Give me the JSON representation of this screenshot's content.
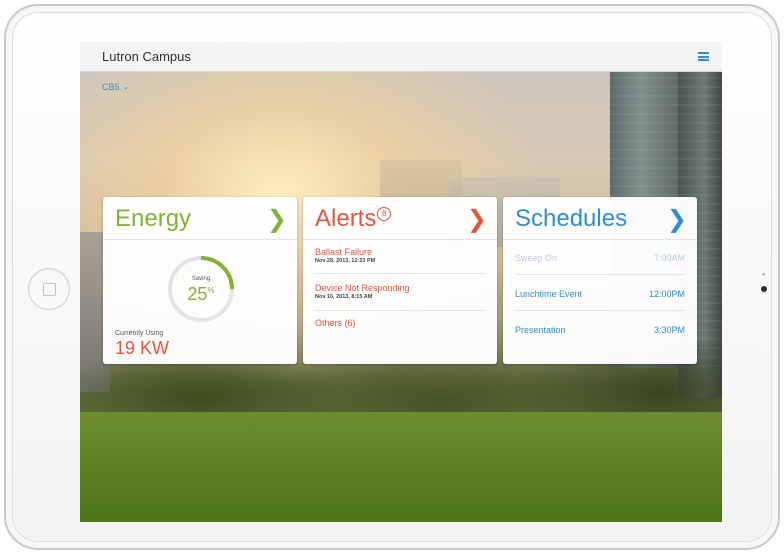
{
  "app": {
    "title": "Lutron Campus",
    "location": "CB5"
  },
  "colors": {
    "energy": "#7fb235",
    "alerts": "#e5553a",
    "schedules": "#2d8fd1"
  },
  "energy": {
    "title": "Energy",
    "saving_label": "Saving",
    "saving_value": "25",
    "saving_unit": "%",
    "saving_fraction": 0.25,
    "current_label": "Currently Using",
    "current_value": "19 KW"
  },
  "alerts": {
    "title": "Alerts",
    "count": "8",
    "items": [
      {
        "name": "Ballast Failure",
        "time": "Nov 28, 2013, 12:23 PM"
      },
      {
        "name": "Device Not Responding",
        "time": "Nov 16, 2013, 8:15 AM"
      }
    ],
    "others": "Others (6)"
  },
  "schedules": {
    "title": "Schedules",
    "items": [
      {
        "name": "Sweep On",
        "time": "7:00AM",
        "past": true
      },
      {
        "name": "Lunchtime Event",
        "time": "12:00PM",
        "past": false
      },
      {
        "name": "Presentation",
        "time": "3:30PM",
        "past": false
      }
    ]
  },
  "icons": {
    "menu": "hamburger-menu-icon",
    "chevron": "chevron-right-icon",
    "dropdown": "chevron-down-icon",
    "home": "home-button-icon"
  }
}
